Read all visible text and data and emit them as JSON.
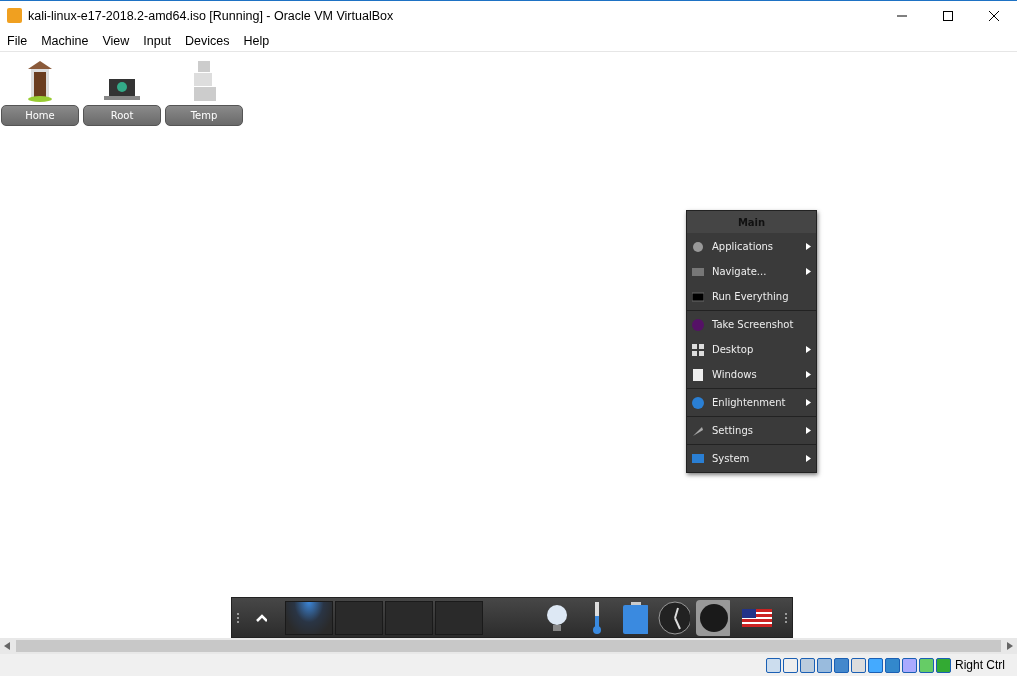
{
  "window": {
    "title": "kali-linux-e17-2018.2-amd64.iso [Running] - Oracle VM VirtualBox"
  },
  "menu_bar": [
    "File",
    "Machine",
    "View",
    "Input",
    "Devices",
    "Help"
  ],
  "desktop_icons": [
    {
      "kind": "home",
      "label": "Home"
    },
    {
      "kind": "root",
      "label": "Root"
    },
    {
      "kind": "temp",
      "label": "Temp"
    }
  ],
  "main_menu": {
    "title": "Main",
    "groups": [
      [
        {
          "kind": "applications",
          "label": "Applications",
          "has_submenu": true
        },
        {
          "kind": "navigate",
          "label": "Navigate...",
          "has_submenu": true
        },
        {
          "kind": "run",
          "label": "Run Everything",
          "has_submenu": false
        }
      ],
      [
        {
          "kind": "screenshot",
          "label": "Take Screenshot",
          "has_submenu": false
        },
        {
          "kind": "desktop",
          "label": "Desktop",
          "has_submenu": true
        },
        {
          "kind": "windows",
          "label": "Windows",
          "has_submenu": true
        }
      ],
      [
        {
          "kind": "enlightenment",
          "label": "Enlightenment",
          "has_submenu": true
        }
      ],
      [
        {
          "kind": "settings",
          "label": "Settings",
          "has_submenu": true
        }
      ],
      [
        {
          "kind": "system",
          "label": "System",
          "has_submenu": true
        }
      ]
    ]
  },
  "shelf": {
    "desks": [
      {
        "selected": true
      },
      {
        "selected": false
      },
      {
        "selected": false
      },
      {
        "selected": false
      }
    ]
  },
  "status_bar": {
    "host_key": "Right Ctrl"
  }
}
